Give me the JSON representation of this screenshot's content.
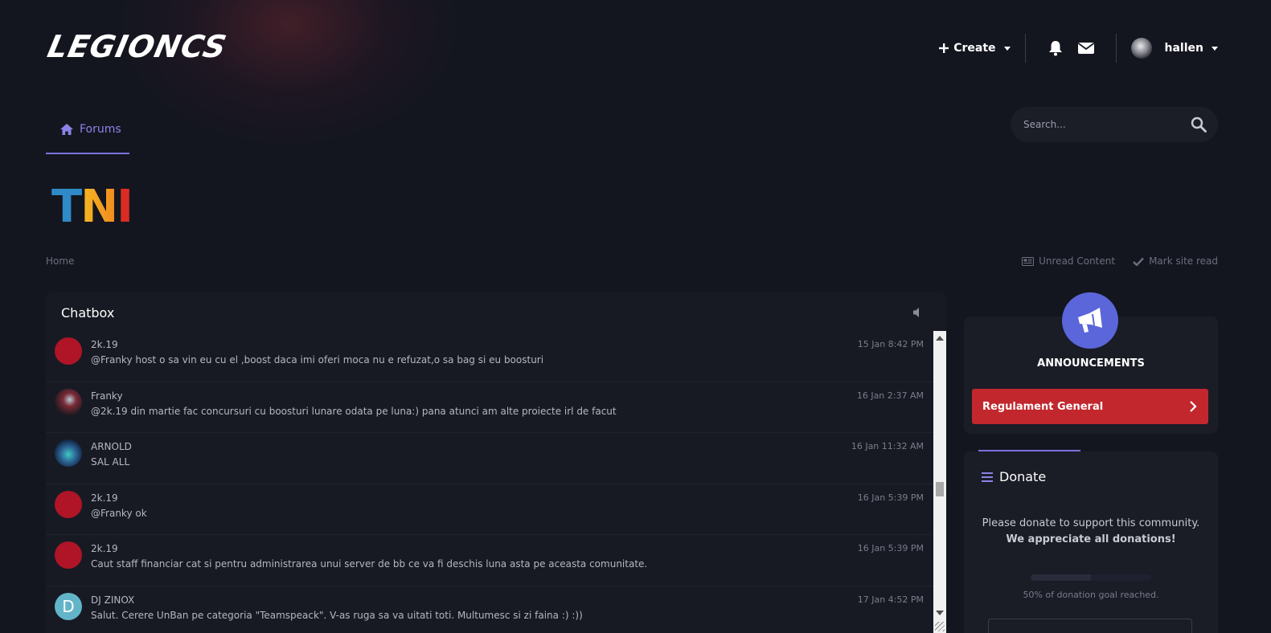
{
  "header": {
    "logo_text": "LEGIONCS",
    "create_label": "Create",
    "username": "hallen",
    "icons": [
      "plus-icon",
      "bell-icon",
      "envelope-icon",
      "user-avatar"
    ]
  },
  "nav": {
    "forums_label": "Forums",
    "search_placeholder": "Search..."
  },
  "banner": {
    "letters": [
      "T",
      "N",
      "I"
    ]
  },
  "breadcrumb": {
    "home_label": "Home"
  },
  "quick_links": {
    "unread_label": "Unread Content",
    "mark_read_label": "Mark site read"
  },
  "chatbox": {
    "title": "Chatbox",
    "messages": [
      {
        "author": "2k.19",
        "text": "@Franky host o sa vin eu cu el ,boost daca imi oferi moca nu e refuzat,o sa bag si eu boosturi",
        "time": "15 Jan 8:42 PM"
      },
      {
        "author": "Franky",
        "text": "@2k.19 din martie fac concursuri cu boosturi lunare odata pe luna:) pana atunci am alte proiecte irl de facut",
        "time": "16 Jan 2:37 AM"
      },
      {
        "author": "ARNOLD",
        "text": "SAL ALL",
        "time": "16 Jan 11:32 AM"
      },
      {
        "author": "2k.19",
        "text": "@Franky ok",
        "time": "16 Jan 5:39 PM"
      },
      {
        "author": "2k.19",
        "text": "Caut staff financiar cat si pentru administrarea unui server de bb ce va fi deschis luna asta pe aceasta comunitate.",
        "time": "16 Jan 5:39 PM"
      },
      {
        "author": "DJ ZINOX",
        "avatar_letter": "D",
        "text": "Salut. Cerere UnBan pe categoria \"Teamspeack\". V-as ruga sa va uitati toti. Multumesc si zi faina :) :))",
        "time": "17 Jan 4:52 PM"
      }
    ]
  },
  "sidebar": {
    "announcements_title": "ANNOUNCEMENTS",
    "announcement_button": "Regulament General",
    "donate_title": "Donate",
    "donate_text": "Please donate to support this community. ",
    "donate_text_bold": "We appreciate all donations!",
    "donation_progress": 0.5,
    "donate_progress_label": "50% of donation goal reached."
  },
  "colors": {
    "accent": "#7b72e0",
    "background": "#14161f",
    "announcement_red": "#c1272d",
    "megaphone_bg": "#5a66d9"
  }
}
